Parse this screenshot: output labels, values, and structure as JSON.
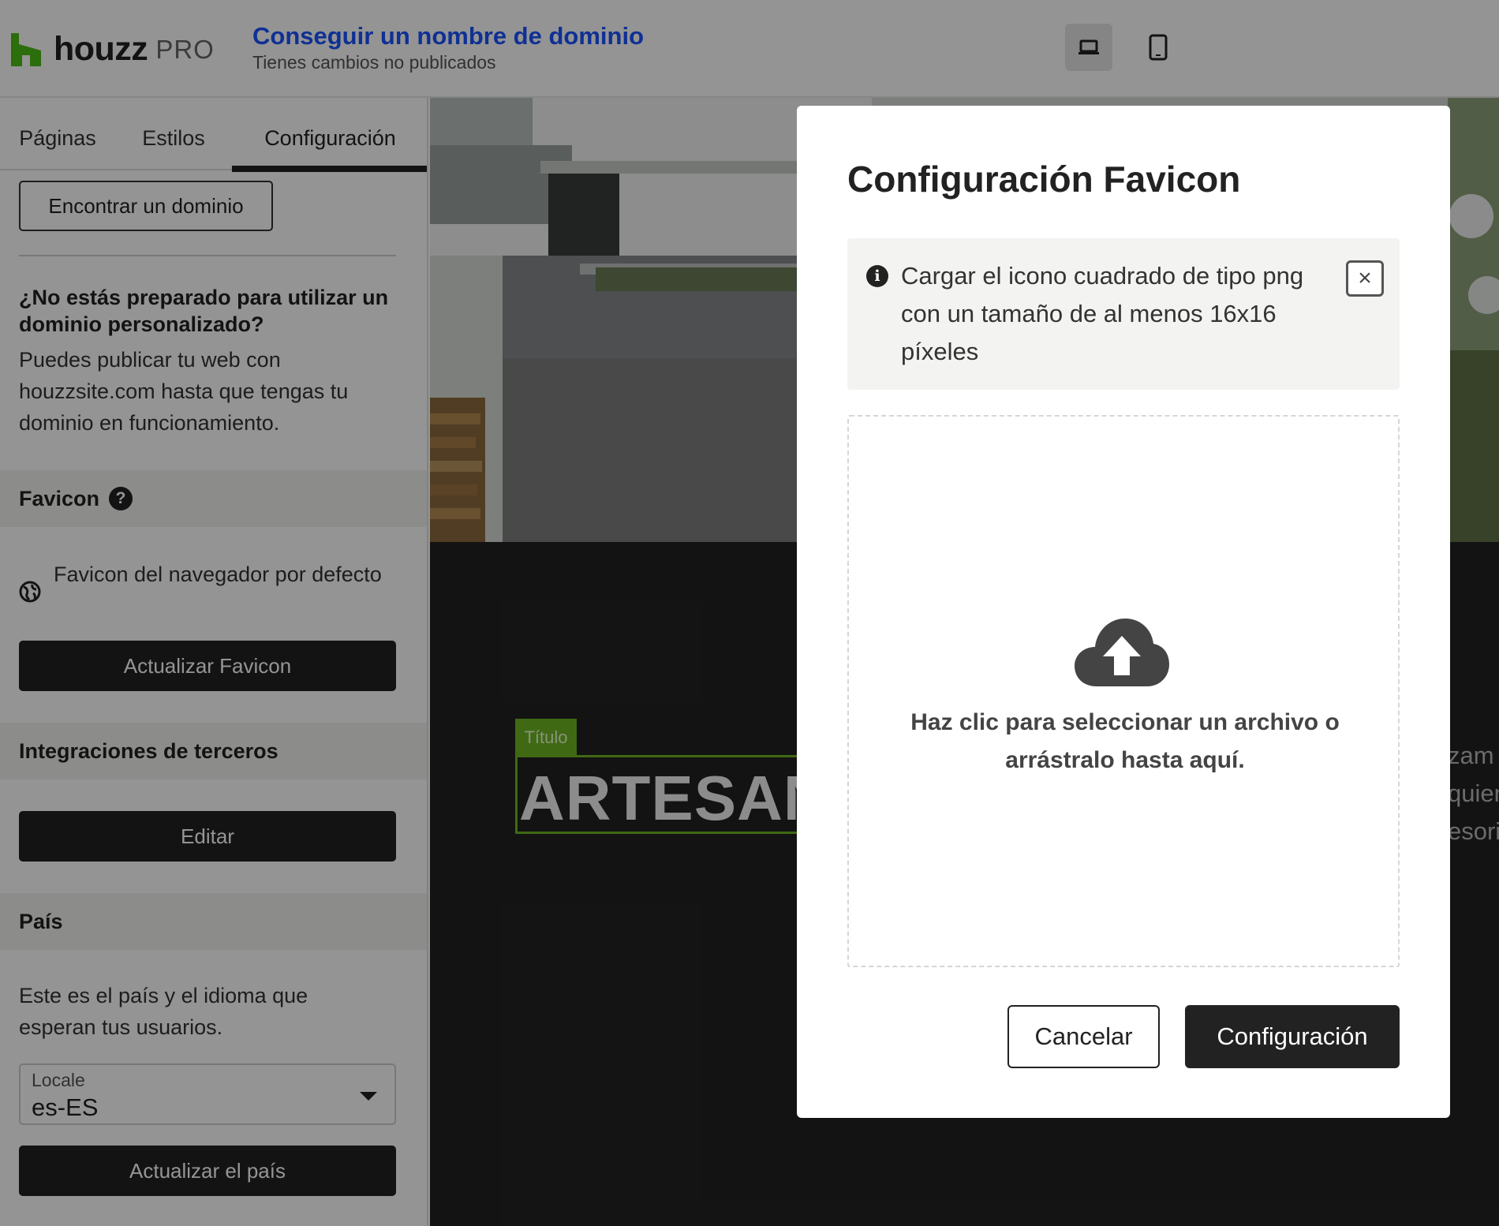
{
  "header": {
    "brand": "houzz",
    "brand_suffix": "PRO",
    "title": "Conseguir un nombre de dominio",
    "subtitle": "Tienes cambios no publicados",
    "devices": [
      "laptop-icon",
      "mobile-icon"
    ],
    "brand_color": "#4dbc15",
    "link_color": "#1a53ff"
  },
  "sidebar": {
    "tabs": [
      "Páginas",
      "Estilos",
      "Configuración"
    ],
    "active_tab": "Configuración",
    "find_domain_label": "Encontrar un dominio",
    "not_ready_title": "¿No estás preparado para utilizar un dominio personalizado?",
    "not_ready_body": "Puedes publicar tu web con houzzsite.com hasta que tengas tu dominio en funcionamiento.",
    "favicon": {
      "title": "Favicon",
      "help_icon": "?",
      "default_label": "Favicon del navegador por defecto",
      "update_label": "Actualizar Favicon"
    },
    "integrations": {
      "title": "Integraciones de terceros",
      "edit_label": "Editar"
    },
    "country": {
      "title": "País",
      "body": "Este es el país y el idioma que esperan tus usuarios.",
      "locale_label": "Locale",
      "locale_value": "es-ES",
      "update_label": "Actualizar el país"
    }
  },
  "preview": {
    "title_tag": "Título",
    "title_text": "ARTESAN",
    "side_lines": [
      "zam",
      "quien",
      "esori"
    ]
  },
  "modal": {
    "title": "Configuración Favicon",
    "notice": "Cargar el icono cuadrado de tipo png con un tamaño de al menos 16x16 píxeles",
    "close_icon": "×",
    "info_icon": "i",
    "drop_text": "Haz clic para seleccionar un archivo o arrástralo hasta aquí.",
    "cancel_label": "Cancelar",
    "confirm_label": "Configuración"
  }
}
